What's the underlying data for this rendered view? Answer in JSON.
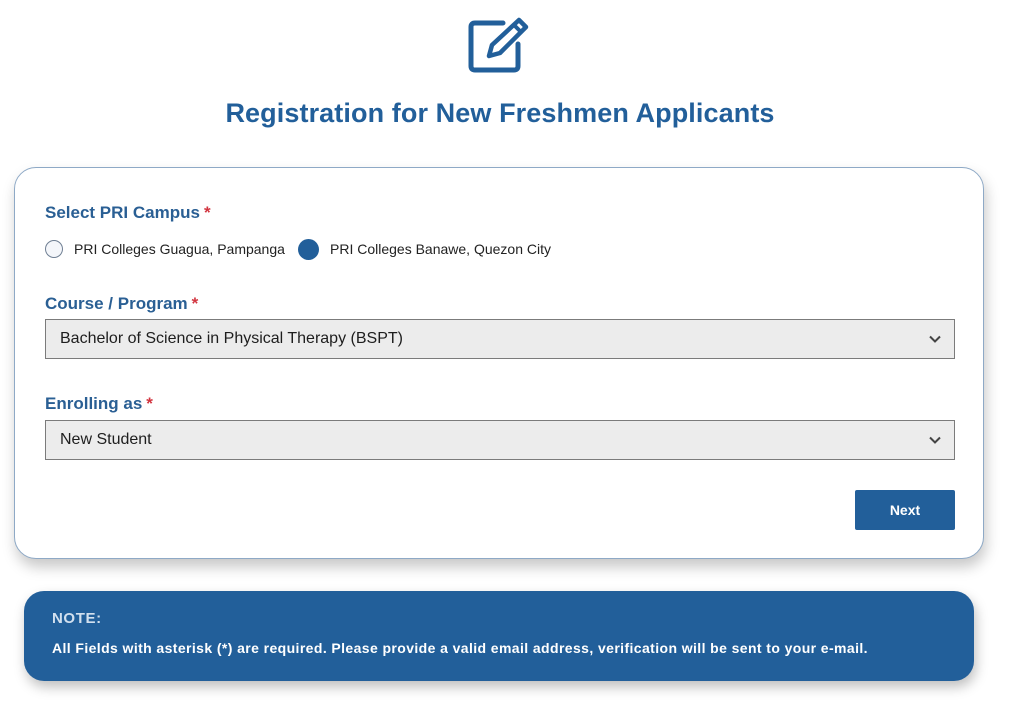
{
  "header": {
    "icon": "edit-icon",
    "title": "Registration for New Freshmen Applicants"
  },
  "form": {
    "campus": {
      "label": "Select PRI Campus",
      "required_mark": "*",
      "options": [
        {
          "label": "PRI Colleges Guagua, Pampanga",
          "selected": false
        },
        {
          "label": "PRI Colleges Banawe, Quezon City",
          "selected": true
        }
      ]
    },
    "course": {
      "label": "Course / Program",
      "required_mark": "*",
      "value": "Bachelor of Science in Physical Therapy (BSPT)"
    },
    "enrolling": {
      "label": "Enrolling as",
      "required_mark": "*",
      "value": "New Student"
    },
    "next_label": "Next"
  },
  "note": {
    "title": "NOTE:",
    "text": "All Fields with asterisk (*) are required. Please provide a valid email address, verification will be sent to your e-mail."
  },
  "colors": {
    "primary": "#225f9a",
    "required": "#d2343f"
  }
}
